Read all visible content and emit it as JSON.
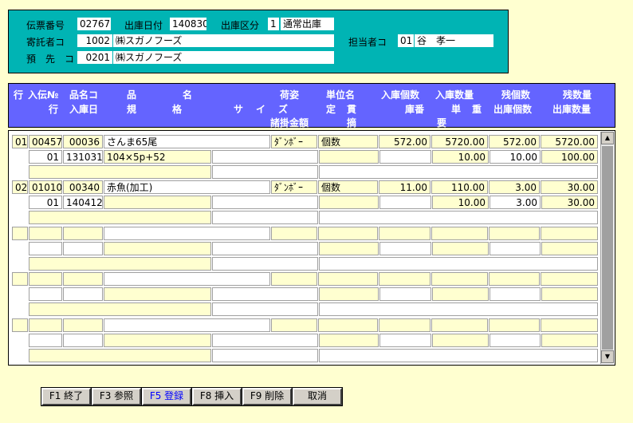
{
  "header": {
    "denpyo_label": "伝票番号",
    "denpyo_value": "02767",
    "date_label": "出庫日付",
    "date_value": "140830",
    "kubun_label": "出庫区分",
    "kubun_code": "1",
    "kubun_name": "通常出庫",
    "kishin_label": "寄託者コ",
    "kishin_code": "1002",
    "kishin_name": "㈱スガノフーズ",
    "tanto_label": "担当者コ",
    "tanto_code": "01",
    "tanto_name": "谷　孝一",
    "yosaki_label": "預　先　コ",
    "yosaki_code": "0201",
    "yosaki_name": "㈱スガノフーズ"
  },
  "columns": {
    "r1": [
      "行",
      "入伝№",
      "品名コ",
      "品",
      "名",
      "荷姿",
      "単位名",
      "入庫個数",
      "入庫数量",
      "残個数",
      "残数量"
    ],
    "r2": [
      "行",
      "入庫日",
      "規",
      "格",
      "サ",
      "イ",
      "ズ",
      "定",
      "貫",
      "庫番",
      "単",
      "重",
      "出庫個数",
      "出庫数量"
    ],
    "r3": [
      "諸掛金額",
      "摘",
      "要"
    ]
  },
  "rows": [
    {
      "gyo": "01",
      "nyuden": "00457",
      "hinmei_code": "00036",
      "hinmei": "さんま65尾",
      "nisugata": "ﾀﾞﾝﾎﾞｰ",
      "tani": "個数",
      "nyuko_kosu": "572.00",
      "nyuko_suryo": "5720.00",
      "zan_kosu": "572.00",
      "zan_suryo": "5720.00",
      "sub_gyo": "01",
      "nyuko_bi": "131031",
      "kikaku": "104×5p+52",
      "tanju": "10.00",
      "shukko_kosu": "10.00",
      "shukko_suryo": "100.00"
    },
    {
      "gyo": "02",
      "nyuden": "01010",
      "hinmei_code": "00340",
      "hinmei": "赤魚(加工)",
      "nisugata": "ﾀﾞﾝﾎﾞｰ",
      "tani": "個数",
      "nyuko_kosu": "11.00",
      "nyuko_suryo": "110.00",
      "zan_kosu": "3.00",
      "zan_suryo": "30.00",
      "sub_gyo": "01",
      "nyuko_bi": "140412",
      "kikaku": "",
      "tanju": "10.00",
      "shukko_kosu": "3.00",
      "shukko_suryo": "30.00"
    }
  ],
  "fkeys": [
    {
      "label": "F1 終了",
      "active": false
    },
    {
      "label": "F3 参照",
      "active": false
    },
    {
      "label": "F5 登録",
      "active": true
    },
    {
      "label": "F8 挿入",
      "active": false
    },
    {
      "label": "F9 削除",
      "active": false
    },
    {
      "label": "取消",
      "active": false
    }
  ]
}
